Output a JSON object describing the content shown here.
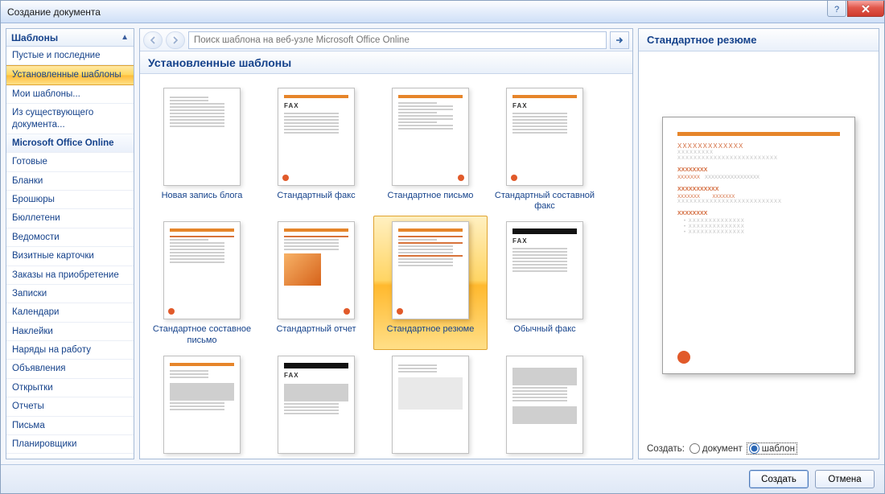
{
  "titlebar": {
    "title": "Создание документа"
  },
  "sidebar": {
    "header": "Шаблоны",
    "items": [
      {
        "label": "Пустые и последние",
        "selected": false
      },
      {
        "label": "Установленные шаблоны",
        "selected": true
      },
      {
        "label": "Мои шаблоны...",
        "selected": false
      },
      {
        "label": "Из существующего документа...",
        "selected": false
      },
      {
        "label": "Microsoft Office Online",
        "section": true
      },
      {
        "label": "Готовые"
      },
      {
        "label": "Бланки"
      },
      {
        "label": "Брошюры"
      },
      {
        "label": "Бюллетени"
      },
      {
        "label": "Ведомости"
      },
      {
        "label": "Визитные карточки"
      },
      {
        "label": "Заказы на приобретение"
      },
      {
        "label": "Записки"
      },
      {
        "label": "Календари"
      },
      {
        "label": "Наклейки"
      },
      {
        "label": "Наряды на работу"
      },
      {
        "label": "Объявления"
      },
      {
        "label": "Открытки"
      },
      {
        "label": "Отчеты"
      },
      {
        "label": "Письма"
      },
      {
        "label": "Планировщики"
      }
    ]
  },
  "search": {
    "placeholder": "Поиск шаблона на веб-узле Microsoft Office Online"
  },
  "content": {
    "heading": "Установленные шаблоны",
    "templates": [
      {
        "label": "Новая запись блога",
        "kind": "blog"
      },
      {
        "label": "Стандартный факс",
        "kind": "fax"
      },
      {
        "label": "Стандартное письмо",
        "kind": "letter"
      },
      {
        "label": "Стандартный составной факс",
        "kind": "fax"
      },
      {
        "label": "Стандартное составное письмо",
        "kind": "letter2"
      },
      {
        "label": "Стандартный отчет",
        "kind": "report"
      },
      {
        "label": "Стандартное резюме",
        "kind": "resume",
        "selected": true
      },
      {
        "label": "Обычный факс",
        "kind": "plainfax"
      },
      {
        "label": "",
        "kind": "letter3"
      },
      {
        "label": "",
        "kind": "bwfax"
      },
      {
        "label": "",
        "kind": "grey"
      },
      {
        "label": "",
        "kind": "grey2"
      }
    ]
  },
  "preview": {
    "heading": "Стандартное резюме",
    "create_label": "Создать:",
    "option_doc": "документ",
    "option_tpl": "шаблон"
  },
  "footer": {
    "create": "Создать",
    "cancel": "Отмена"
  }
}
